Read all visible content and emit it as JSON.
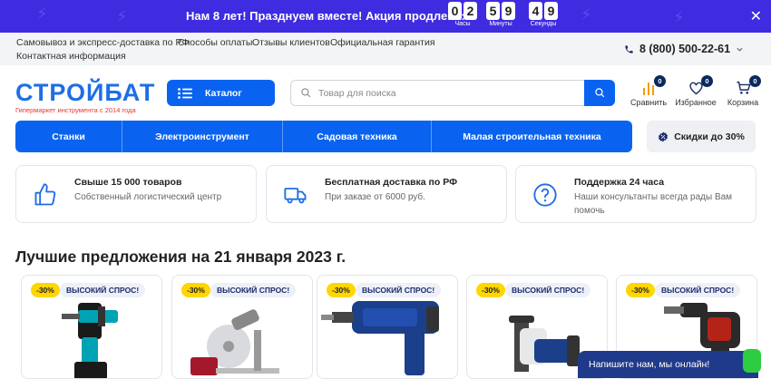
{
  "promo": {
    "text": "Нам 8 лет! Празднуем вместе! Акция продлена:",
    "countdown": [
      {
        "digits": [
          "0",
          "2"
        ],
        "label": "Часы"
      },
      {
        "digits": [
          "5",
          "9"
        ],
        "label": "Минуты"
      },
      {
        "digits": [
          "4",
          "9"
        ],
        "label": "Секунды"
      }
    ]
  },
  "topbar": {
    "links": [
      "Самовывоз и экспресс-доставка по РФ",
      "Способы оплаты",
      "Отзывы клиентов",
      "Официальная гарантия",
      "Контактная информация"
    ],
    "phone": "8 (800) 500-22-61"
  },
  "logo": {
    "title": "СТРОЙБАТ",
    "subtitle": "Гипермаркет инструмента с 2014 года"
  },
  "catalog_label": "Каталог",
  "search": {
    "placeholder": "Товар для поиска"
  },
  "actions": [
    {
      "label": "Сравнить",
      "count": "0",
      "icon": "compare-icon"
    },
    {
      "label": "Избранное",
      "count": "0",
      "icon": "heart-icon"
    },
    {
      "label": "Корзина",
      "count": "0",
      "icon": "cart-icon"
    }
  ],
  "nav": [
    "Станки",
    "Электроинструмент",
    "Садовая техника",
    "Малая строительная техника"
  ],
  "discount_label": "Скидки до 30%",
  "features": [
    {
      "title": "Свыше 15 000 товаров",
      "desc": "Собственный логистический центр",
      "icon": "thumbs-up-icon"
    },
    {
      "title": "Бесплатная доставка по РФ",
      "desc": "При заказе от 6000 руб.",
      "icon": "truck-icon"
    },
    {
      "title": "Поддержка 24 часа",
      "desc": "Наши консультанты всегда рады Вам помочь",
      "icon": "question-icon"
    }
  ],
  "section_title": "Лучшие предложения на 21 января 2023 г.",
  "products": [
    {
      "sale": "-30%",
      "badge": "ВЫСОКИЙ СПРОС!"
    },
    {
      "sale": "-30%",
      "badge": "ВЫСОКИЙ СПРОС!"
    },
    {
      "sale": "-30%",
      "badge": "ВЫСОКИЙ СПРОС!"
    },
    {
      "sale": "-30%",
      "badge": "ВЫСОКИЙ СПРОС!"
    },
    {
      "sale": "-30%",
      "badge": "ВЫСОКИЙ СПРОС!"
    }
  ],
  "chat_label": "Напишите нам, мы онлайн!",
  "colors": {
    "brand_blue": "#0a63f0",
    "promo_purple": "#3f2be0",
    "sale_yellow": "#ffd600",
    "chat_navy": "#1f3a8a",
    "online_green": "#2ecc40"
  }
}
